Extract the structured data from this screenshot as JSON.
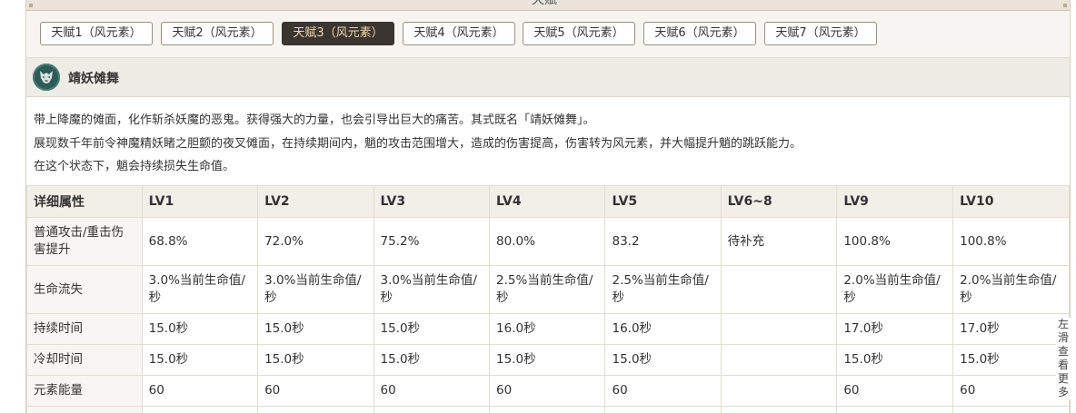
{
  "section_title": "天赋",
  "tabs": [
    {
      "label": "天赋1（风元素）"
    },
    {
      "label": "天赋2（风元素）"
    },
    {
      "label": "天赋3（风元素）"
    },
    {
      "label": "天赋4（风元素）"
    },
    {
      "label": "天赋5（风元素）"
    },
    {
      "label": "天赋6（风元素）"
    },
    {
      "label": "天赋7（风元素）"
    }
  ],
  "active_tab": 2,
  "skill": {
    "name": "靖妖傩舞",
    "icon": "yaksha-mask-icon",
    "description": [
      "带上降魔的傩面，化作斩杀妖魔的恶鬼。获得强大的力量，也会引导出巨大的痛苦。其式既名「靖妖傩舞」。",
      "展现数千年前令神魔精妖睹之胆颤的夜叉傩面，在持续期间内，魈的攻击范围增大，造成的伤害提高，伤害转为风元素，并大幅提升魈的跳跃能力。",
      "在这个状态下，魈会持续损失生命值。"
    ]
  },
  "table": {
    "headers": [
      "详细属性",
      "LV1",
      "LV2",
      "LV3",
      "LV4",
      "LV5",
      "LV6~8",
      "LV9",
      "LV10"
    ],
    "rows": [
      {
        "label": "普通攻击/重击伤害提升",
        "values": [
          "68.8%",
          "72.0%",
          "75.2%",
          "80.0%",
          "83.2",
          "待补充",
          "100.8%",
          "100.8%"
        ]
      },
      {
        "label": "生命流失",
        "values": [
          "3.0%当前生命值/秒",
          "3.0%当前生命值/秒",
          "3.0%当前生命值/秒",
          "2.5%当前生命值/秒",
          "2.5%当前生命值/秒",
          "",
          "2.0%当前生命值/秒",
          "2.0%当前生命值/秒"
        ]
      },
      {
        "label": "持续时间",
        "values": [
          "15.0秒",
          "15.0秒",
          "15.0秒",
          "16.0秒",
          "16.0秒",
          "",
          "17.0秒",
          "17.0秒"
        ]
      },
      {
        "label": "冷却时间",
        "values": [
          "15.0秒",
          "15.0秒",
          "15.0秒",
          "15.0秒",
          "15.0秒",
          "",
          "15.0秒",
          "15.0秒"
        ]
      },
      {
        "label": "元素能量",
        "values": [
          "60",
          "60",
          "60",
          "60",
          "60",
          "",
          "60",
          "60"
        ]
      },
      {
        "label": "",
        "values": [
          "",
          "",
          "",
          "",
          "",
          "",
          "",
          ""
        ]
      }
    ]
  },
  "scroll_hint": "左滑查看更多",
  "colors": {
    "active_tab_bg": "#3a3530",
    "active_tab_text": "#f0d9a8",
    "header_bg": "#f2efe9"
  }
}
